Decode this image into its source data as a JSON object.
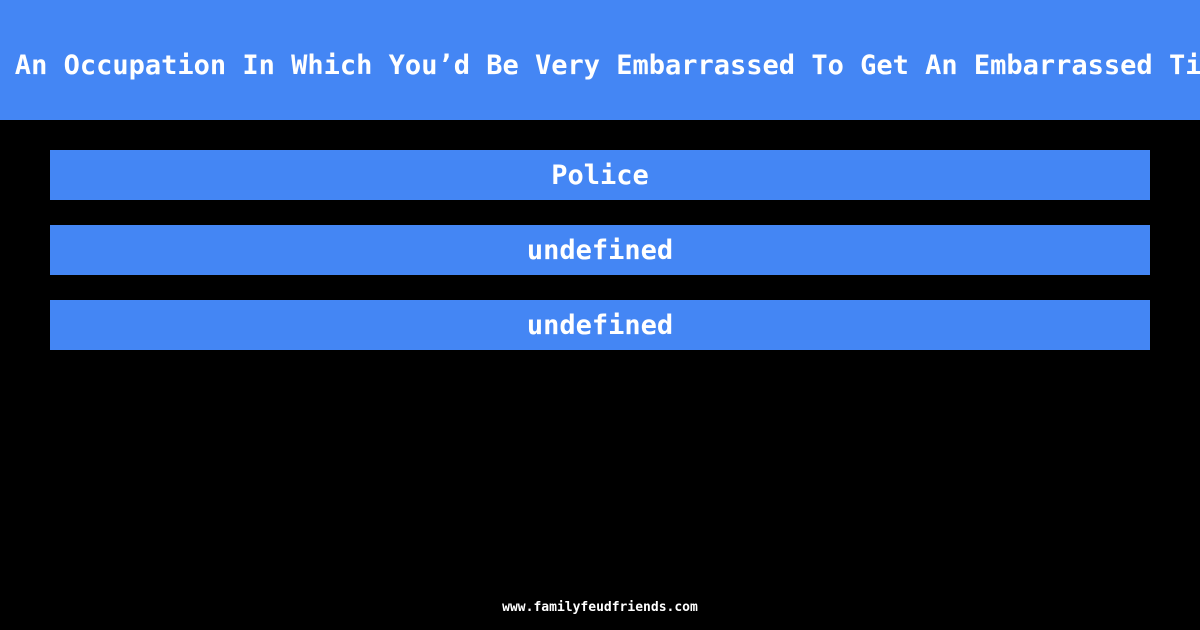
{
  "question": {
    "title": "e An Occupation In Which You’d Be Very Embarrassed To Get An Embarrassed Tic"
  },
  "answers": [
    {
      "label": "Police"
    },
    {
      "label": "undefined"
    },
    {
      "label": "undefined"
    }
  ],
  "footer": {
    "site": "www.familyfeudfriends.com"
  },
  "colors": {
    "accent": "#4486F4",
    "background": "#000000",
    "text": "#FFFFFF"
  }
}
